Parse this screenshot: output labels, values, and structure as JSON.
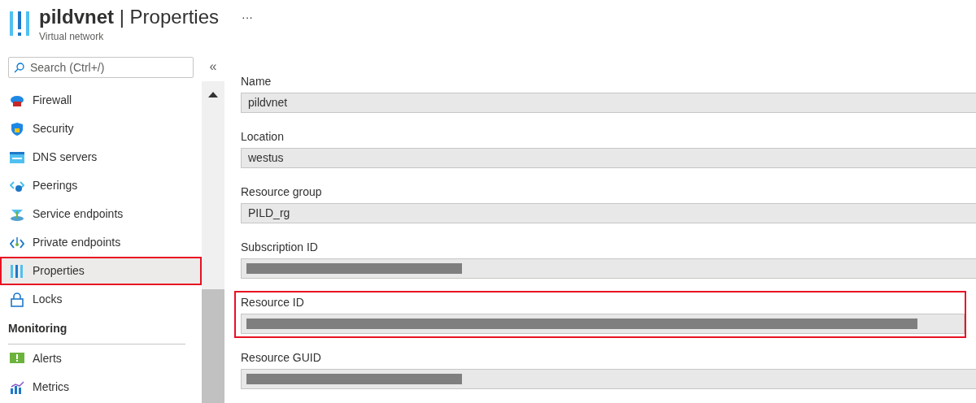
{
  "header": {
    "title_bold": "pildvnet",
    "title_rest": "| Properties",
    "subtitle": "Virtual network",
    "more": "···"
  },
  "search": {
    "placeholder": "Search (Ctrl+/)"
  },
  "collapse": "«",
  "sidebar": {
    "items": [
      {
        "kind": "item",
        "label": "Firewall",
        "selected": false,
        "highlighted": false
      },
      {
        "kind": "item",
        "label": "Security",
        "selected": false,
        "highlighted": false
      },
      {
        "kind": "item",
        "label": "DNS servers",
        "selected": false,
        "highlighted": false
      },
      {
        "kind": "item",
        "label": "Peerings",
        "selected": false,
        "highlighted": false
      },
      {
        "kind": "item",
        "label": "Service endpoints",
        "selected": false,
        "highlighted": false
      },
      {
        "kind": "item",
        "label": "Private endpoints",
        "selected": false,
        "highlighted": false
      },
      {
        "kind": "item",
        "label": "Properties",
        "selected": true,
        "highlighted": true
      },
      {
        "kind": "item",
        "label": "Locks",
        "selected": false,
        "highlighted": false
      },
      {
        "kind": "section",
        "label": "Monitoring"
      },
      {
        "kind": "item",
        "label": "Alerts",
        "selected": false,
        "highlighted": false
      },
      {
        "kind": "item",
        "label": "Metrics",
        "selected": false,
        "highlighted": false
      }
    ]
  },
  "fields": [
    {
      "label": "Name",
      "kind": "text",
      "value": "pildvnet",
      "highlighted": false
    },
    {
      "label": "Location",
      "kind": "text",
      "value": "westus",
      "highlighted": false
    },
    {
      "label": "Resource group",
      "kind": "text",
      "value": "PILD_rg",
      "highlighted": false
    },
    {
      "label": "Subscription ID",
      "kind": "redacted_short",
      "highlighted": false
    },
    {
      "label": "Resource ID",
      "kind": "redacted_long",
      "highlighted": true
    },
    {
      "label": "Resource GUID",
      "kind": "redacted_short",
      "highlighted": false
    }
  ]
}
